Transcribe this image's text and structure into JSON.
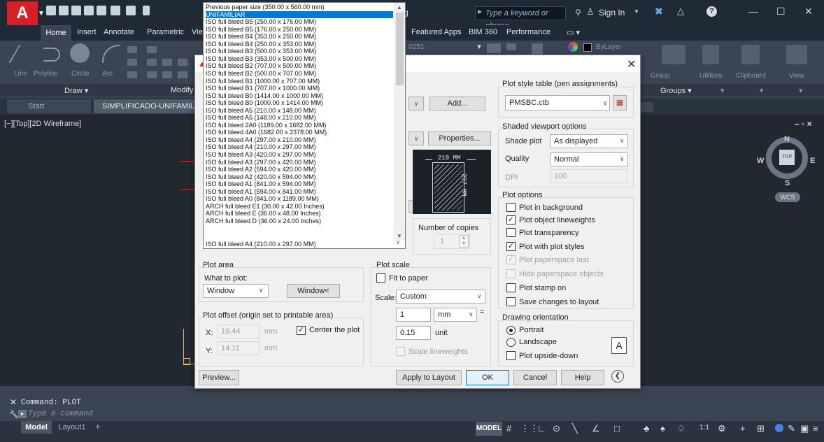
{
  "titlebar": {
    "title_fragment": "g",
    "search_placeholder": "Type a keyword or phrase",
    "sign_in": "Sign In",
    "help": "?",
    "minimize": "—",
    "maximize": "☐",
    "close": "✕"
  },
  "ribbon": {
    "tabs": [
      "Home",
      "Insert",
      "Annotate",
      "Parametric",
      "View",
      "Featured Apps",
      "BIM 360",
      "Performance"
    ],
    "item_labels": [
      "Line",
      "Polyline",
      "Circle",
      "Arc",
      "Group",
      "Utilities",
      "Clipboard",
      "View"
    ],
    "layer_name": "ByLayer",
    "layer_fragment": "0251",
    "panels": {
      "draw": "Draw ▾",
      "modify": "Modify",
      "groups": "Groups ▾"
    }
  },
  "file_tabs": {
    "start": "Start",
    "file": "SIMPLIFICADO-UNIFAMILIAR"
  },
  "viewport": {
    "label": "[−][Top][2D Wireframe]",
    "controls": "– ▫ ×",
    "cube_top": "TOP",
    "compass": {
      "n": "N",
      "s": "S",
      "e": "E",
      "w": "W"
    },
    "wcs": "WCS"
  },
  "command": {
    "history": "Command: PLOT",
    "placeholder": "Type a command"
  },
  "status": {
    "model_tab": "Model",
    "layout_tab": "Layout1",
    "add_tab": "+",
    "model_button": "MODEL",
    "scale": "1:1"
  },
  "dialog": {
    "printer": {
      "add_button": "Add...",
      "properties_button": "Properties..."
    },
    "paper_preview": {
      "width": "210 MM",
      "height": "297 MM"
    },
    "paper_size": {
      "selected": "UNIFAMILIAR",
      "current_value": "ISO full bleed A4 (210.00 x 297.00 MM)",
      "options": [
        "Previous paper size  (350.00 x 560.00 mm)",
        "UNIFAMILIAR",
        "ISO full bleed B5 (250.00 x 176.00 MM)",
        "ISO full bleed B5 (176.00 x 250.00 MM)",
        "ISO full bleed B4 (353.00 x 250.00 MM)",
        "ISO full bleed B4 (250.00 x 353.00 MM)",
        "ISO full bleed B3 (500.00 x 353.00 MM)",
        "ISO full bleed B3 (353.00 x 500.00 MM)",
        "ISO full bleed B2 (707.00 x 500.00 MM)",
        "ISO full bleed B2 (500.00 x 707.00 MM)",
        "ISO full bleed B1 (1000.00 x 707.00 MM)",
        "ISO full bleed B1 (707.00 x 1000.00 MM)",
        "ISO full bleed B0 (1414.00 x 1000.00 MM)",
        "ISO full bleed B0 (1000.00 x 1414.00 MM)",
        "ISO full bleed A5 (210.00 x 148.00 MM)",
        "ISO full bleed A5 (148.00 x 210.00 MM)",
        "ISO full bleed 2A0 (1189.00 x 1682.00 MM)",
        "ISO full bleed 4A0 (1682.00 x 2378.00 MM)",
        "ISO full bleed A4 (297.00 x 210.00 MM)",
        "ISO full bleed A4 (210.00 x 297.00 MM)",
        "ISO full bleed A3 (420.00 x 297.00 MM)",
        "ISO full bleed A3 (297.00 x 420.00 MM)",
        "ISO full bleed A2 (594.00 x 420.00 MM)",
        "ISO full bleed A2 (420.00 x 594.00 MM)",
        "ISO full bleed A1 (841.00 x 594.00 MM)",
        "ISO full bleed A1 (594.00 x 841.00 MM)",
        "ISO full bleed A0 (841.00 x 1189.00 MM)",
        "ARCH full bleed E1 (30.00 x 42.00 Inches)",
        "ARCH full bleed E (36.00 x 48.00 Inches)",
        "ARCH full bleed D (36.00 x 24.00 Inches)"
      ]
    },
    "copies": {
      "label": "Number of copies",
      "value": "1"
    },
    "plot_area": {
      "title": "Plot area",
      "what_label": "What to plot:",
      "what_value": "Window",
      "window_button": "Window<"
    },
    "plot_offset": {
      "title": "Plot offset (origin set to printable area)",
      "x_label": "X:",
      "x_value": "19.44",
      "x_unit": "mm",
      "y_label": "Y:",
      "y_value": "14.11",
      "y_unit": "mm",
      "center_label": "Center the plot"
    },
    "plot_scale": {
      "title": "Plot scale",
      "fit_label": "Fit to paper",
      "scale_label": "Scale:",
      "scale_value": "Custom",
      "value1": "1",
      "unit1": "mm",
      "value2": "0.15",
      "unit2": "unit",
      "lineweights_label": "Scale lineweights",
      "equals": "="
    },
    "plot_style_table": {
      "title": "Plot style table (pen assignments)",
      "value": "PMSBC.ctb"
    },
    "shaded_viewport": {
      "title": "Shaded viewport options",
      "shade_label": "Shade plot",
      "shade_value": "As displayed",
      "quality_label": "Quality",
      "quality_value": "Normal",
      "dpi_label": "DPI",
      "dpi_value": "100"
    },
    "plot_options": {
      "title": "Plot options",
      "items": [
        "Plot in background",
        "Plot object lineweights",
        "Plot transparency",
        "Plot with plot styles",
        "Plot paperspace last",
        "Hide paperspace objects",
        "Plot stamp on",
        "Save changes to layout"
      ]
    },
    "orientation": {
      "title": "Drawing orientation",
      "portrait": "Portrait",
      "landscape": "Landscape",
      "upside_down": "Plot upside-down",
      "icon_letter": "A"
    },
    "buttons": {
      "preview": "Preview...",
      "apply": "Apply to Layout",
      "ok": "OK",
      "cancel": "Cancel",
      "help": "Help"
    }
  },
  "colors": {
    "accent": "#0078d7",
    "titlebar": "#1f2a36",
    "ribbon": "#3b4453",
    "drawing": "#212830",
    "logo": "#d81f26"
  }
}
